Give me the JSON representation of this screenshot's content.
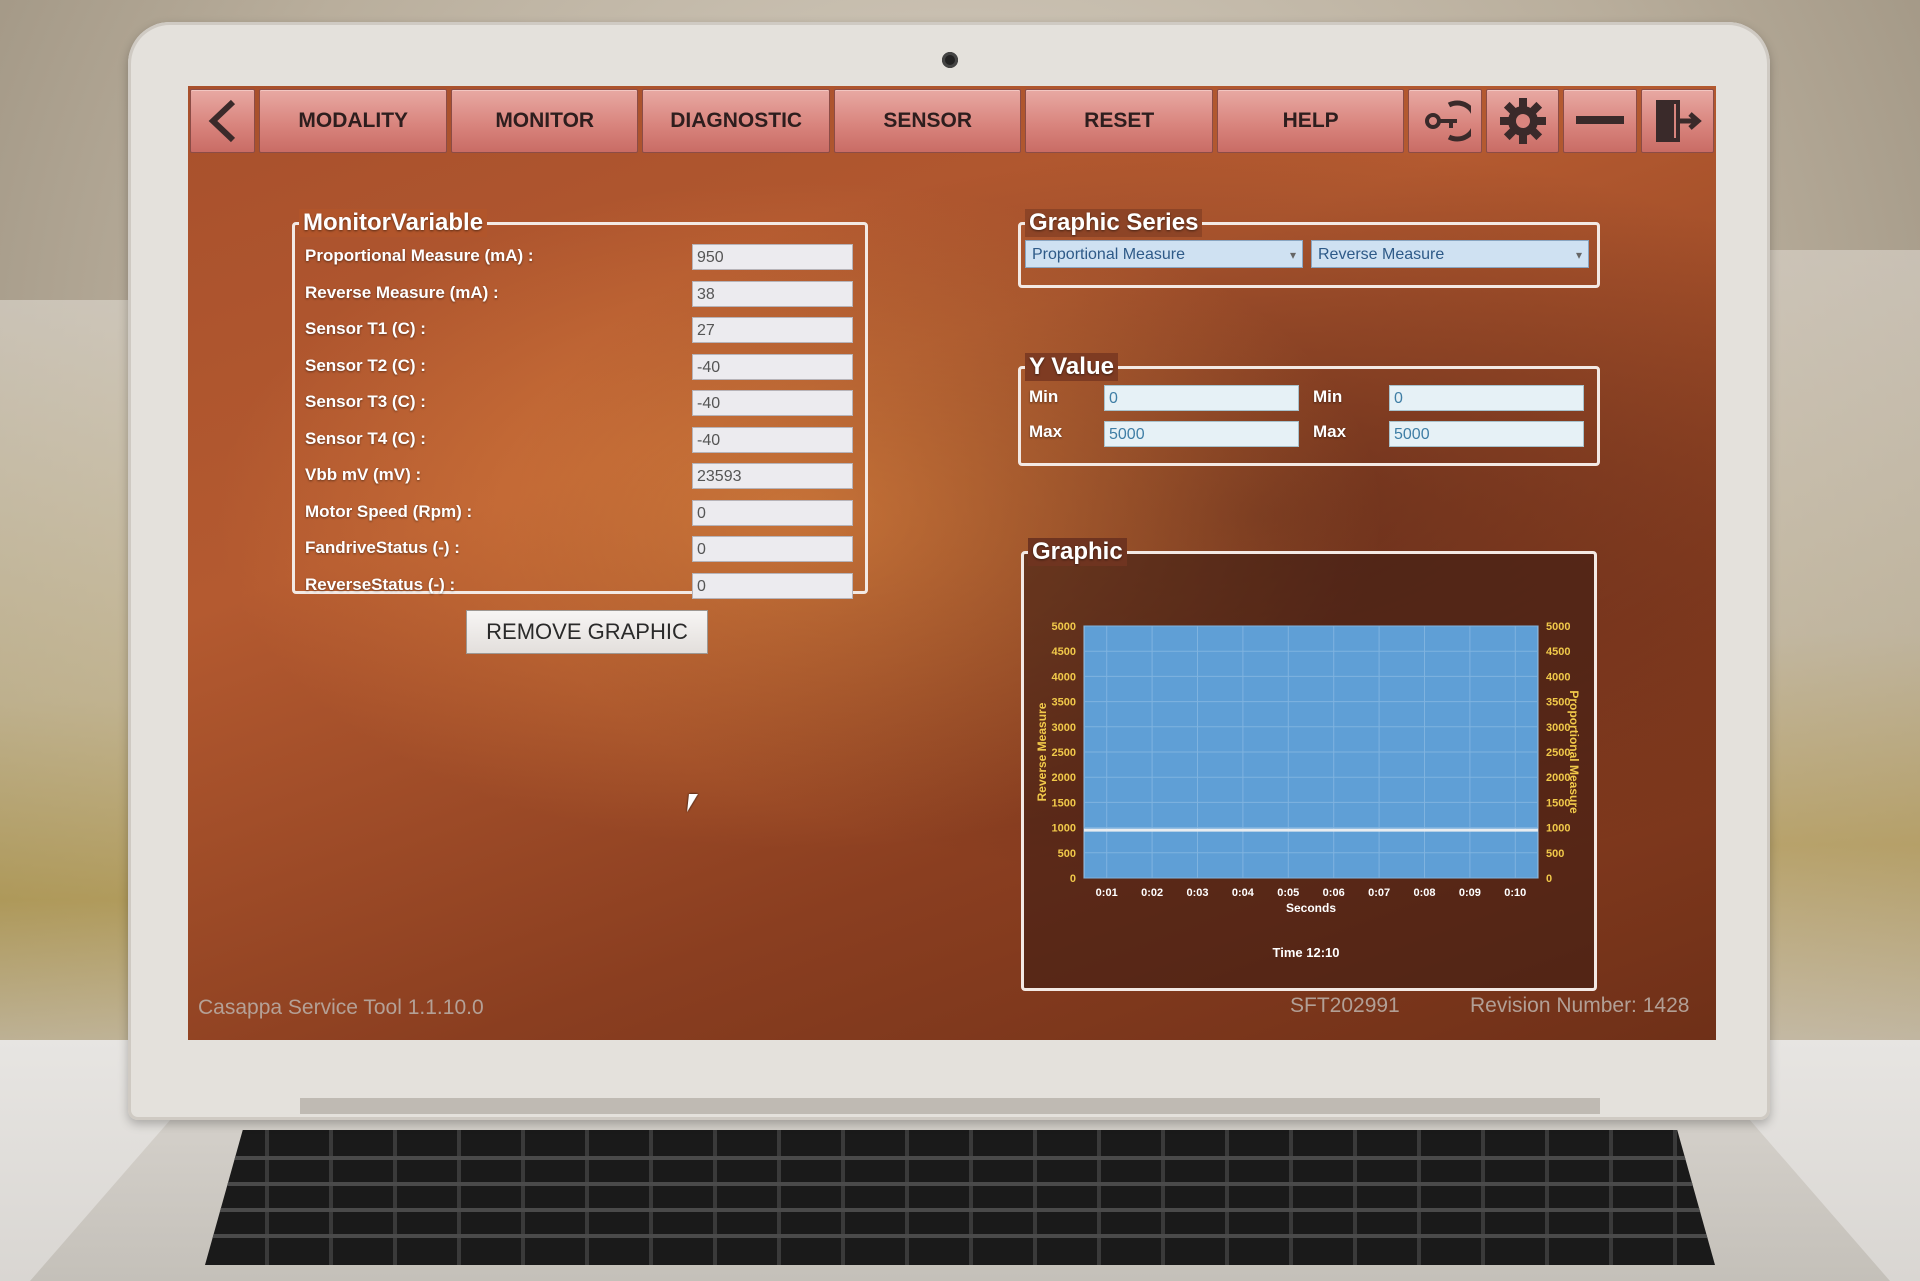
{
  "toolbar": {
    "back_icon": "chevron-left-icon",
    "buttons": [
      "MODALITY",
      "MONITOR",
      "DIAGNOSTIC",
      "SENSOR",
      "RESET",
      "HELP"
    ],
    "icons": [
      "key-login-icon",
      "gear-icon",
      "minimize-icon",
      "exit-door-icon"
    ]
  },
  "monitor_variable": {
    "title": "MonitorVariable",
    "rows": [
      {
        "label": "Proportional Measure (mA) :",
        "value": "950"
      },
      {
        "label": "Reverse Measure (mA) :",
        "value": "38"
      },
      {
        "label": "Sensor T1 (C) :",
        "value": "27"
      },
      {
        "label": "Sensor T2 (C) :",
        "value": "-40"
      },
      {
        "label": "Sensor T3 (C) :",
        "value": "-40"
      },
      {
        "label": "Sensor T4 (C) :",
        "value": "-40"
      },
      {
        "label": "Vbb mV (mV) :",
        "value": "23593"
      },
      {
        "label": "Motor Speed (Rpm) :",
        "value": "0"
      },
      {
        "label": "FandriveStatus (-) :",
        "value": "0"
      },
      {
        "label": "ReverseStatus (-) :",
        "value": "0"
      }
    ],
    "remove_button": "REMOVE GRAPHIC"
  },
  "graphic_series": {
    "title": "Graphic Series",
    "series1": "Proportional Measure",
    "series2": "Reverse Measure"
  },
  "y_value": {
    "title": "Y Value",
    "min_label": "Min",
    "max_label": "Max",
    "left_min": "0",
    "left_max": "5000",
    "right_min": "0",
    "right_max": "5000"
  },
  "graphic": {
    "title": "Graphic",
    "time_label": "Time 12:10"
  },
  "chart_data": {
    "type": "line",
    "x": [
      "0:01",
      "0:02",
      "0:03",
      "0:04",
      "0:05",
      "0:06",
      "0:07",
      "0:08",
      "0:09",
      "0:10"
    ],
    "xlabel": "Seconds",
    "ylabel_left": "Reverse Measure",
    "ylabel_right": "Proportional Measure",
    "ylim": [
      0,
      5000
    ],
    "yticks": [
      0,
      500,
      1000,
      1500,
      2000,
      2500,
      3000,
      3500,
      4000,
      4500,
      5000
    ],
    "series": [
      {
        "name": "Proportional Measure",
        "values": [
          950,
          950,
          950,
          950,
          950,
          950,
          950,
          950,
          950,
          950
        ]
      }
    ],
    "plot_bg": "#5f9fd6",
    "line_color": "#e8ecf0"
  },
  "footer": {
    "app_version": "Casappa Service Tool 1.1.10.0",
    "serial": "SFT202991",
    "revision": "Revision Number: 1428"
  }
}
